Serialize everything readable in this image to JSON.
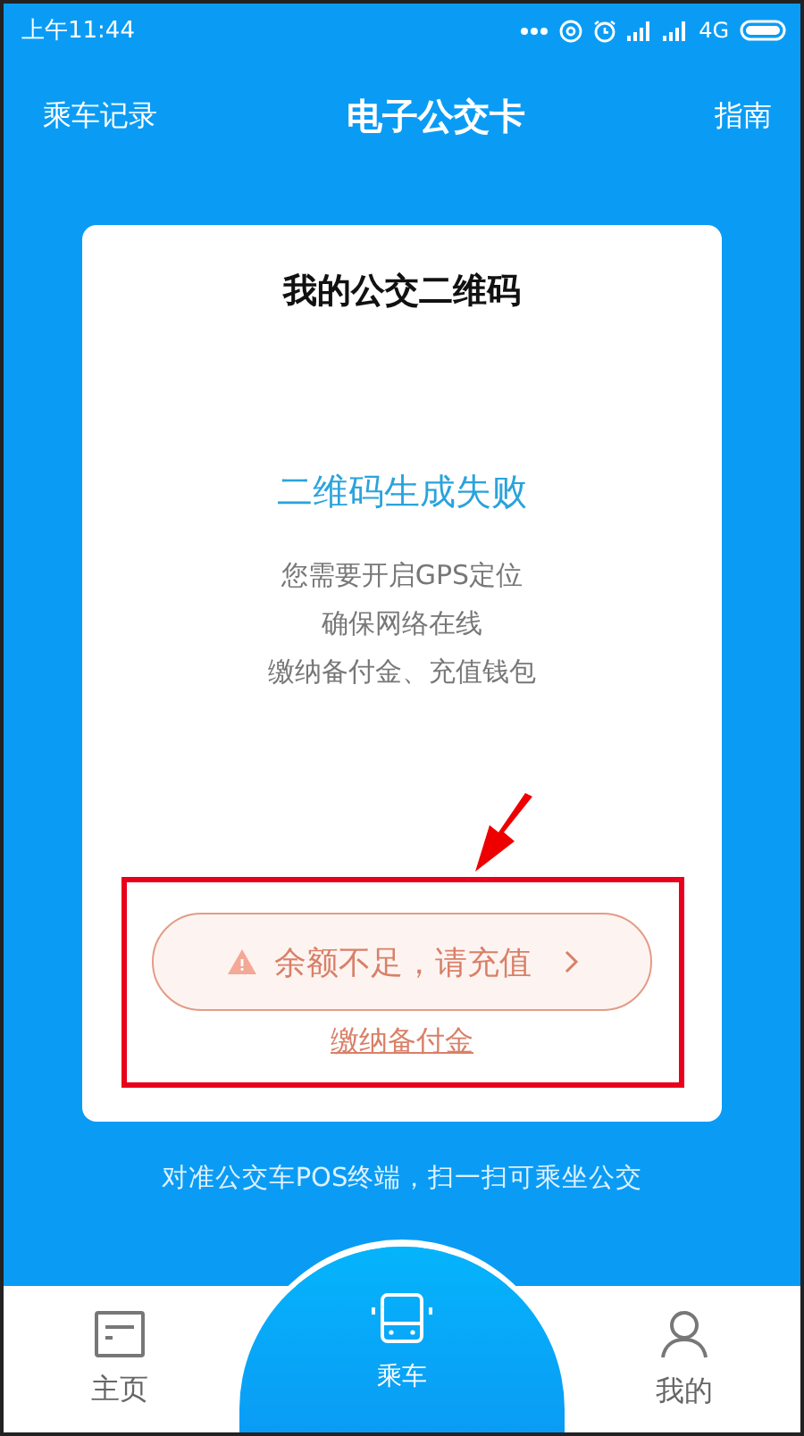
{
  "status_bar": {
    "time": "上午11:44",
    "network": "4G"
  },
  "header": {
    "left": "乘车记录",
    "title": "电子公交卡",
    "right": "指南"
  },
  "card": {
    "title": "我的公交二维码",
    "error": "二维码生成失败",
    "requirements": [
      "您需要开启GPS定位",
      "确保网络在线",
      "缴纳备付金、充值钱包"
    ],
    "recharge_button": "余额不足，请充值",
    "deposit_link": "缴纳备付金"
  },
  "tip": "对准公交车POS终端，扫一扫可乘坐公交",
  "tabs": [
    {
      "label": "主页",
      "kind": "home",
      "selected": false
    },
    {
      "label": "乘车",
      "kind": "bus",
      "selected": true
    },
    {
      "label": "我的",
      "kind": "me",
      "selected": false
    }
  ]
}
